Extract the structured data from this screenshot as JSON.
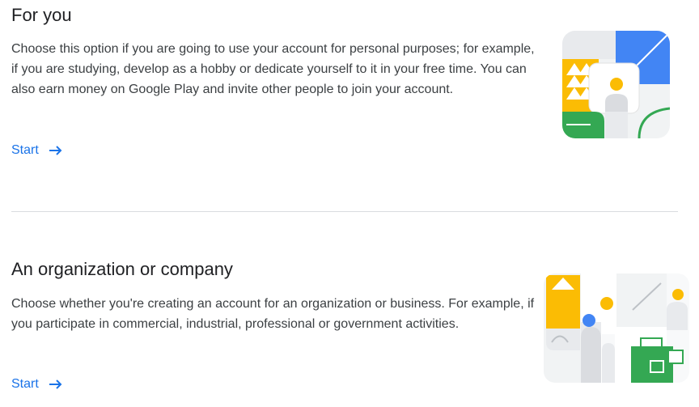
{
  "personal": {
    "title": "For you",
    "description": "Choose this option if you are going to use your account for personal purposes; for example, if you are studying, develop as a hobby or dedicate yourself to it in your free time. You can also earn money on Google Play and invite other people to join your account.",
    "start_label": "Start",
    "arrow_icon": "arrow-right-icon",
    "illustration": "personal-account-illustration"
  },
  "organization": {
    "title": "An organization or company",
    "description": "Choose whether you're creating an account for an organization or business. For example, if you participate in commercial, industrial, professional or government activities.",
    "start_label": "Start",
    "arrow_icon": "arrow-right-icon",
    "illustration": "organization-account-illustration"
  },
  "colors": {
    "link": "#1a73e8",
    "google_blue": "#4285f4",
    "google_yellow": "#fbbc04",
    "google_green": "#34a853",
    "divider": "#dadce0"
  }
}
